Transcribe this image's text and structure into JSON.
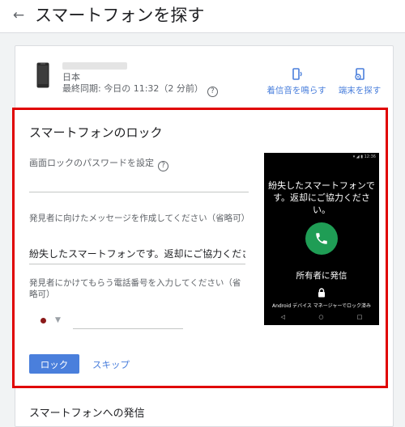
{
  "header": {
    "title": "スマートフォンを探す",
    "back_icon": "arrow-left-icon"
  },
  "device": {
    "country": "日本",
    "last_sync": "最終同期: 今日の 11:32（2 分前）",
    "help_glyph": "?",
    "actions": {
      "ring_label": "着信音を鳴らす",
      "find_label": "端末を探す"
    }
  },
  "lock_section": {
    "title": "スマートフォンのロック",
    "password_label": "画面ロックのパスワードを設定",
    "message_label": "発見者に向けたメッセージを作成してください（省略可）",
    "message_value": "紛失したスマートフォンです。返却にご協力くださ",
    "phone_label": "発見者にかけてもらう電話番号を入力してください（省略可）",
    "dropdown_glyph": "▼",
    "lock_button": "ロック",
    "skip_link": "スキップ"
  },
  "preview": {
    "status_text": "▾ ◢ ▮ 12:36",
    "message": "紛失したスマートフォンです。返却にご協力ください。",
    "call_owner": "所有者に発信",
    "managed_text": "Android デバイス マネージャーでロック済み",
    "nav_back": "◁",
    "nav_home": "○",
    "nav_recent": "□"
  },
  "next_section": {
    "title": "スマートフォンへの発信"
  },
  "colors": {
    "accent": "#4a7fdc",
    "highlight_border": "#e00000",
    "call_green": "#1f9d55"
  }
}
